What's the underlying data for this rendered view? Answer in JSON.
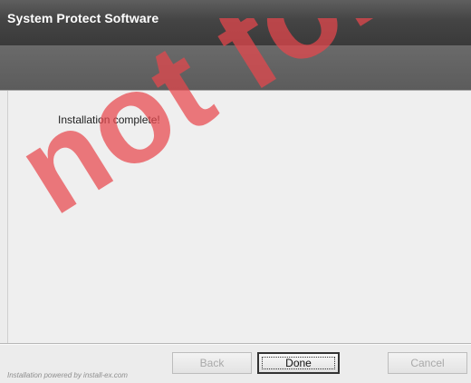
{
  "window": {
    "title": "System Protect Software"
  },
  "content": {
    "message": "Installation complete!"
  },
  "footer": {
    "credit": "Installation powered by install-ex.com"
  },
  "buttons": {
    "back": "Back",
    "done": "Done",
    "cancel": "Cancel"
  },
  "watermark": {
    "text": "not for",
    "color": "#e8474c"
  }
}
